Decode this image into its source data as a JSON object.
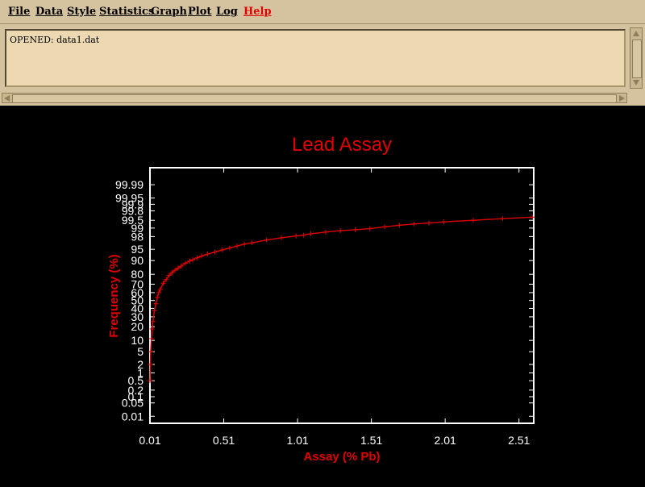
{
  "menu": {
    "items": [
      {
        "label": "File"
      },
      {
        "label": "Data"
      },
      {
        "label": "Style"
      },
      {
        "label": "Statistics"
      },
      {
        "label": "Graph"
      },
      {
        "label": "Plot"
      },
      {
        "label": "Log"
      },
      {
        "label": "Help",
        "color": "#e00000"
      }
    ]
  },
  "log": {
    "text": "OPENED: data1.dat"
  },
  "colors": {
    "menubar": "#d5c29f",
    "textarea": "#ecd9b2",
    "plot_background": "#000000",
    "axes": "#ffffff",
    "accent": "#e00000"
  },
  "chart_data": {
    "type": "line",
    "title": "Lead Assay",
    "xlabel": "Assay (% Pb)",
    "ylabel": "Frequency (%)",
    "y_scale": "probability",
    "xlim": [
      0.01,
      2.61
    ],
    "ylim": [
      0.004,
      99.999
    ],
    "x_ticks": [
      "0.01",
      "0.51",
      "1.01",
      "1.51",
      "2.01",
      "2.51"
    ],
    "y_ticks": [
      "0.01",
      "0.05",
      "0.1",
      "0.2",
      "0.5",
      "1",
      "2",
      "5",
      "10",
      "20",
      "30",
      "40",
      "50",
      "60",
      "70",
      "80",
      "90",
      "95",
      "98",
      "99",
      "99.5",
      "99.8",
      "99.9",
      "99.95",
      "99.99"
    ],
    "series": [
      {
        "color": "#e00000",
        "x": [
          0.01,
          0.012,
          0.015,
          0.02,
          0.025,
          0.03,
          0.04,
          0.05,
          0.06,
          0.07,
          0.08,
          0.1,
          0.12,
          0.14,
          0.16,
          0.18,
          0.2,
          0.22,
          0.25,
          0.28,
          0.3,
          0.33,
          0.36,
          0.4,
          0.45,
          0.5,
          0.55,
          0.6,
          0.65,
          0.7,
          0.8,
          0.9,
          1.0,
          1.05,
          1.1,
          1.2,
          1.3,
          1.4,
          1.5,
          1.6,
          1.7,
          1.8,
          1.9,
          2.0,
          2.2,
          2.4,
          2.6
        ],
        "y": [
          0.5,
          2,
          5,
          11,
          18,
          25,
          37,
          46,
          54,
          60,
          64,
          71,
          75,
          79,
          81.5,
          83.5,
          85,
          86.5,
          88.5,
          89.8,
          90.5,
          91.5,
          92.3,
          93.2,
          94,
          94.8,
          95.4,
          96,
          96.5,
          96.8,
          97.4,
          97.8,
          98.1,
          98.2,
          98.4,
          98.6,
          98.75,
          98.85,
          98.95,
          99.1,
          99.22,
          99.3,
          99.36,
          99.42,
          99.5,
          99.57,
          99.63
        ]
      }
    ]
  }
}
